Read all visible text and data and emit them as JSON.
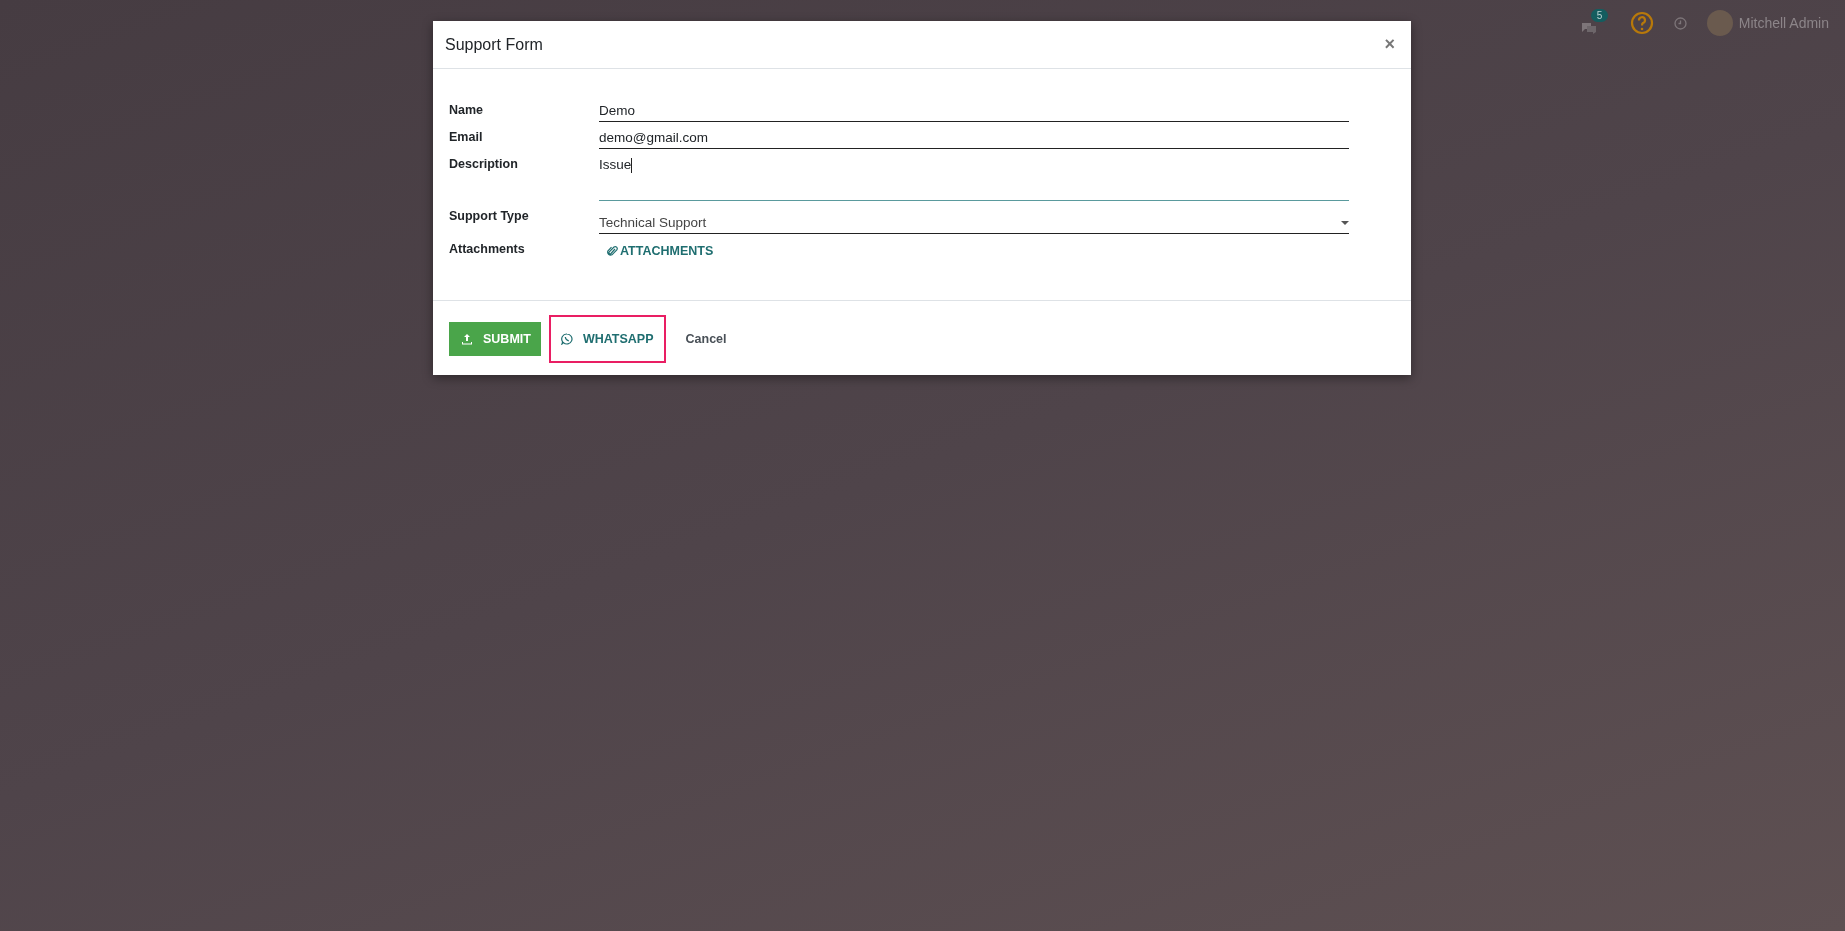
{
  "topbar": {
    "messages_count": "5",
    "user": {
      "name": "Mitchell Admin"
    }
  },
  "dialog": {
    "title": "Support Form",
    "close": "×",
    "fields": [
      {
        "kind": "text",
        "label": "Name",
        "value": "Demo"
      },
      {
        "kind": "text",
        "label": "Email",
        "value": "demo@gmail.com"
      },
      {
        "kind": "textarea",
        "label": "Description",
        "value": "Issue",
        "focused": true
      },
      {
        "kind": "select",
        "label": "Support Type",
        "value": "Technical Support"
      },
      {
        "kind": "attachment",
        "label": "Attachments",
        "value": "ATTACHMENTS"
      }
    ],
    "buttons": [
      {
        "kind": "primary",
        "label": "SUBMIT",
        "highlighted": false
      },
      {
        "kind": "whatsapp",
        "label": "WHATSAPP",
        "highlighted": true
      },
      {
        "kind": "link",
        "label": "Cancel",
        "highlighted": false
      }
    ]
  }
}
